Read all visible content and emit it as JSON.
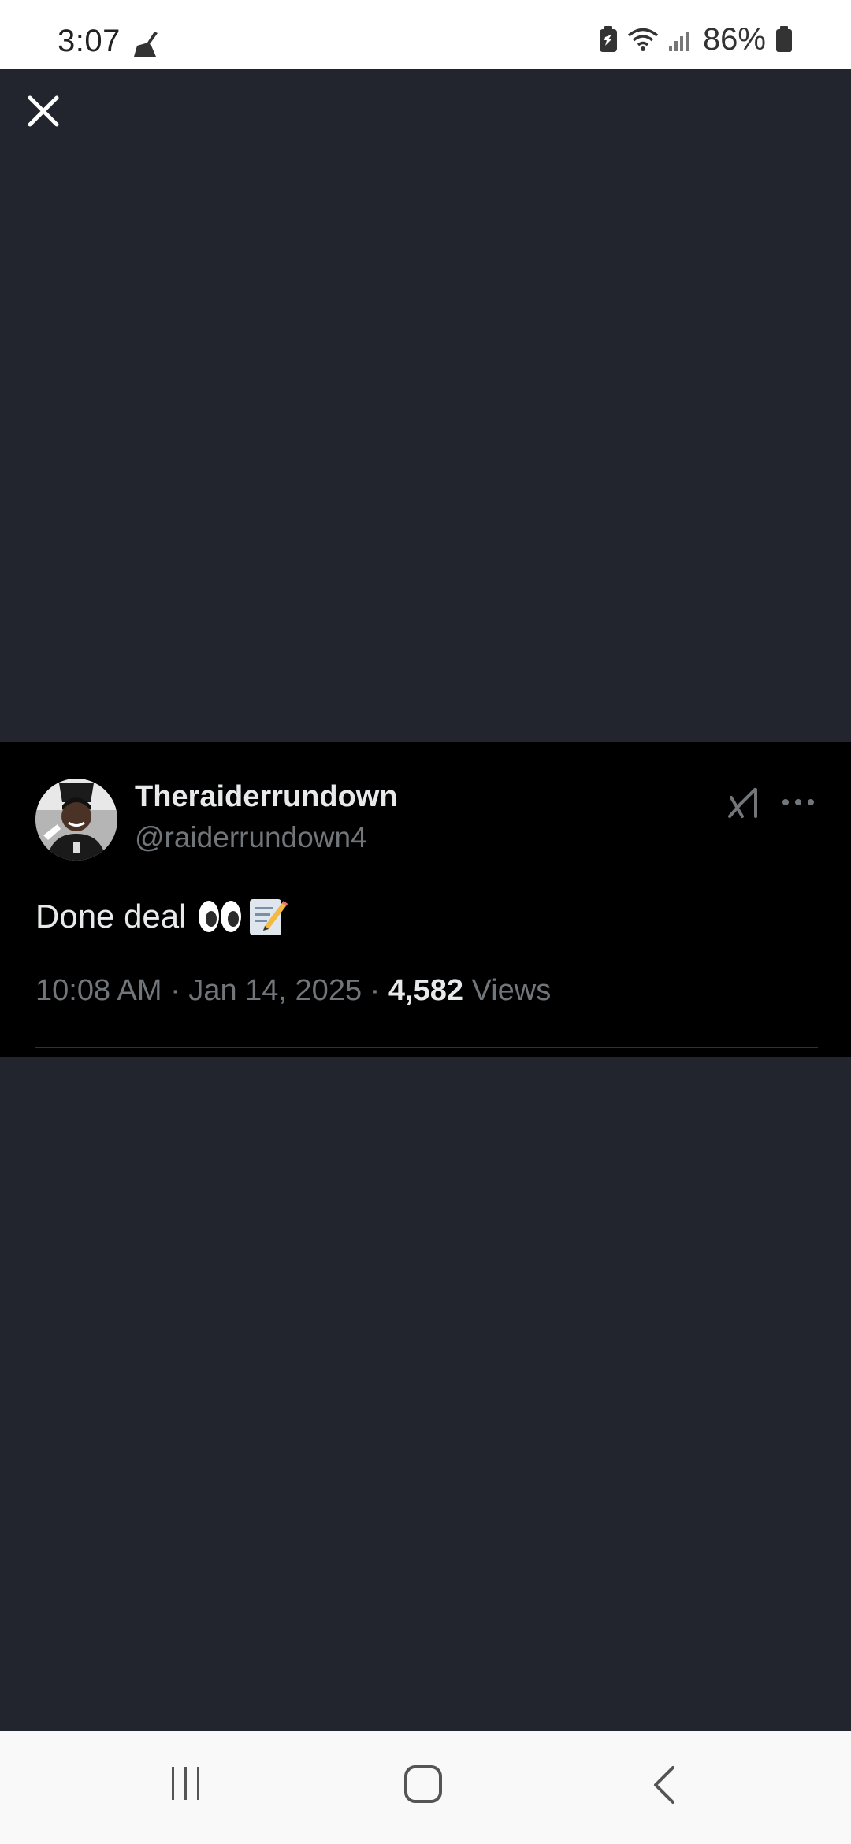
{
  "status_bar": {
    "time": "3:07",
    "battery_percent": "86%"
  },
  "tweet": {
    "display_name": "Theraiderrundown",
    "handle": "@raiderrundown4",
    "text": "Done deal",
    "emojis": [
      "eyes-emoji",
      "memo-emoji"
    ],
    "time": "10:08 AM",
    "date": "Jan 14, 2025",
    "views_count": "4,582",
    "views_label": "Views"
  },
  "icons": {
    "close": "close-icon",
    "grok": "grok-icon",
    "more": "more-icon",
    "recents": "recents-icon",
    "home": "home-icon",
    "back": "back-icon"
  },
  "colors": {
    "viewer_background": "#22252d",
    "card_background": "#000000",
    "primary_text": "#e7e9ea",
    "secondary_text": "#71767b"
  }
}
